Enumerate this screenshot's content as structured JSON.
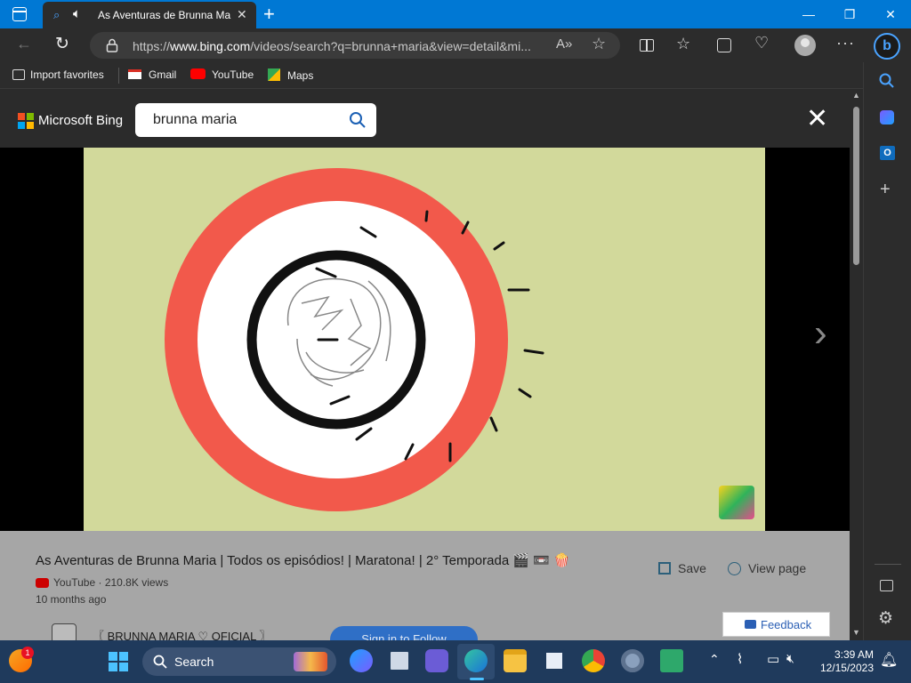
{
  "browser": {
    "tab_title": "As Aventuras de Brunna Maria | Todos",
    "tab_close": "✕",
    "window": {
      "minimize": "—",
      "restore": "❐",
      "close": "✕"
    },
    "url_prefix": "https://",
    "url_host": "www.bing.com",
    "url_rest": "/videos/search?q=brunna+maria&view=detail&mi...",
    "new_tab": "+"
  },
  "favorites": [
    {
      "label": "Import favorites"
    },
    {
      "label": "Gmail"
    },
    {
      "label": "YouTube"
    },
    {
      "label": "Maps"
    }
  ],
  "bing": {
    "logo_text": "Microsoft Bing",
    "search_value": "brunna maria",
    "close": "✕"
  },
  "video": {
    "title": "As Aventuras de Brunna Maria | Todos os episódios! | Maratona! | 2° Temporada 🎬 📼 🍿",
    "source": "YouTube · 210.8K views",
    "age": "10 months ago",
    "channel": "〖 BRUNNA MARIA ♡ OFICIAL 〗",
    "save_label": "Save",
    "view_page_label": "View page",
    "feedback_label": "Feedback",
    "signin_label": "Sign in to Follow",
    "next": "›"
  },
  "taskbar": {
    "search_label": "Search",
    "time": "3:39 AM",
    "date": "12/15/2023",
    "weather_badge": "1"
  },
  "colors": {
    "edge_blue": "#0078d4",
    "video_bg": "#d2d99b",
    "ring_red": "#f2594b",
    "taskbar": "#1f3a5c"
  }
}
